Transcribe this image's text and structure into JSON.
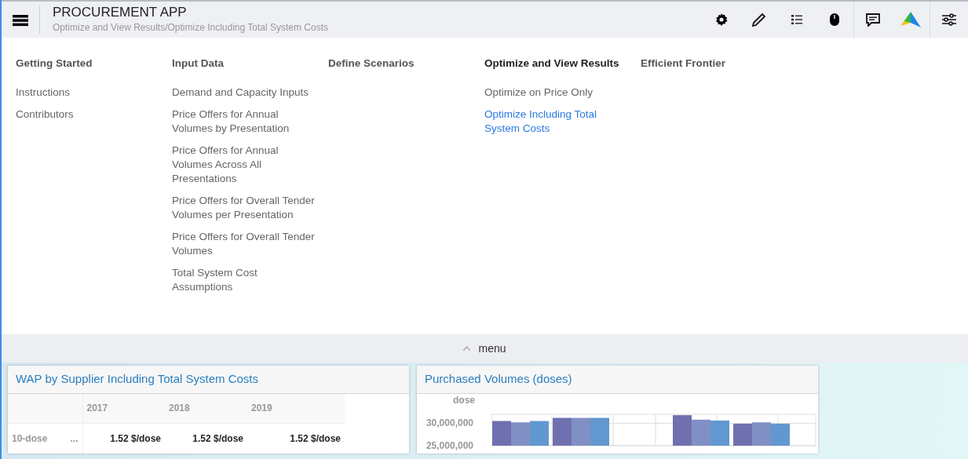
{
  "header": {
    "title": "PROCUREMENT APP",
    "breadcrumb": "Optimize and View Results/Optimize Including Total System Costs"
  },
  "menu": {
    "columns": [
      {
        "heading": "Getting Started",
        "selected": false,
        "items": [
          {
            "label": "Instructions",
            "selected": false
          },
          {
            "label": "Contributors",
            "selected": false
          }
        ]
      },
      {
        "heading": "Input Data",
        "selected": false,
        "items": [
          {
            "label": "Demand and Capacity Inputs",
            "selected": false
          },
          {
            "label": "Price Offers for Annual Volumes by Presentation",
            "selected": false
          },
          {
            "label": "Price Offers for Annual Volumes Across All Presentations",
            "selected": false
          },
          {
            "label": "Price Offers for Overall Tender Volumes per Presentation",
            "selected": false
          },
          {
            "label": "Price Offers for Overall Tender Volumes",
            "selected": false
          },
          {
            "label": "Total System Cost Assumptions",
            "selected": false
          }
        ]
      },
      {
        "heading": "Define Scenarios",
        "selected": false
      },
      {
        "heading": "Optimize and View Results",
        "selected": true,
        "items": [
          {
            "label": "Optimize on Price Only",
            "selected": false
          },
          {
            "label": "Optimize Including Total System Costs",
            "selected": true
          }
        ]
      },
      {
        "heading": "Efficient Frontier",
        "selected": false
      }
    ],
    "toggle": {
      "label": "menu",
      "expanded": true
    }
  },
  "wap_card": {
    "title": "WAP by Supplier Including Total System Costs",
    "table": {
      "columns": [
        "2017",
        "2018",
        "2019"
      ],
      "rows": [
        {
          "label": "10-dose",
          "more": "...",
          "cells": [
            "1.52 $/dose",
            "1.52 $/dose",
            "1.52 $/dose"
          ]
        }
      ]
    }
  },
  "volumes_card": {
    "title": "Purchased Volumes (doses)",
    "chart_data": {
      "type": "bar",
      "stacked": false,
      "ylabel": "dose",
      "ylim": [
        25000000,
        32000000
      ],
      "yticks": [
        {
          "value": 30000000,
          "label": "30,000,000"
        },
        {
          "value": 25000000,
          "label": "25,000,000"
        }
      ],
      "series": [
        {
          "color": "#7070b0",
          "values": [
            30500000,
            31200000,
            31800000,
            29900000
          ]
        },
        {
          "color": "#8190c4",
          "values": [
            30200000,
            31200000,
            30800000,
            30200000
          ]
        },
        {
          "color": "#6298d0",
          "values": [
            30500000,
            31200000,
            30600000,
            29900000
          ]
        }
      ]
    }
  }
}
